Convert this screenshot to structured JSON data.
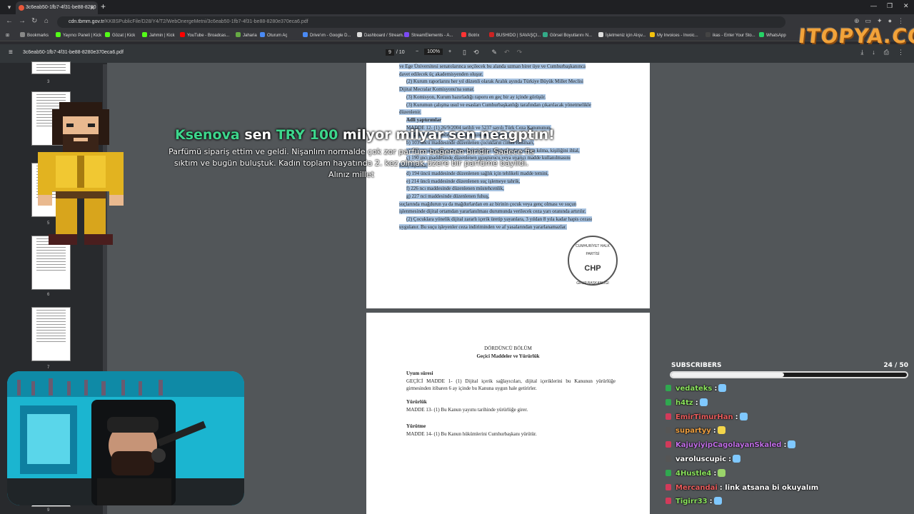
{
  "browser": {
    "tab_title": "3c6eab50-1fb7-4f31-be88-8280",
    "url_host": "cdn.tbmm.gov.tr",
    "url_path": "/KKBSPublicFile/D28/Y4/T2/WebOnergeMetni/3c6eab50-1fb7-4f31-be88-8280e370eca6.pdf",
    "bookmarks": [
      "Bookmarks",
      "Yayıncı Paneli | Kick",
      "Gözat | Kick",
      "Jahmin | Kick",
      "YouTube - Broadcas...",
      "Jaharia",
      "Oturum Aç",
      "Drive'ım - Google D...",
      "Dashboard / Stream...",
      "StreamElements - A...",
      "Botrix",
      "BUSHIDO | SAVAŞÇI...",
      "Görsel Boyutlarını N...",
      "İşletmeniz için Alışv...",
      "My Invoices - Invoic...",
      "ikas - Enter Your Sto...",
      "WhatsApp"
    ],
    "bookmark_colors": [
      "#888",
      "#53fc18",
      "#53fc18",
      "#53fc18",
      "#ff0000",
      "#6a4",
      "#4a8af4",
      "#4a8af4",
      "#ddd",
      "#7b4af4",
      "#f33",
      "#c22",
      "#3a8",
      "#ddd",
      "#f4c20d",
      "#444",
      "#25d366"
    ]
  },
  "logo_text": "ITOPYA.COM",
  "pdf": {
    "filename": "3c6eab50-1fb7-4f31-be88-8280e370eca6.pdf",
    "page_current": "9",
    "page_total": "/ 10",
    "zoom": "100%",
    "thumb_numbers": [
      "3",
      "5",
      "6",
      "7",
      "9"
    ],
    "page1_lines": [
      "ve Ege Üniversitesi senatolarınca seçilecek bu alanda uzman birer üye ve Cumhurbaşkanınca",
      "davet edilecek üç akademisyenden oluşur.",
      "(2) Kurum raporlarını her yıl düzenli olarak Aralık ayında Türkiye Büyük Millet Meclisi",
      "Dijital Mecralar Komisyonu'na sunar.",
      "(3) Komisyon, Kurum hazırladığı raporu en geç bir ay içinde görüşür.",
      "(3) Kurumun çalışma usul ve esasları Cumhurbaşkanlığı tarafından çıkarılacak yönetmelikle",
      "düzenlenir.",
      "",
      "Adli yaptırımlar",
      "MADDE 12- (1) 26/9/2004 tarihli ve 5237 sayılı Türk Ceza Kanununun,",
      "a) 82 nci maddesinde düzenlenen nitelikli öldürme,",
      "b) 103 üncü maddesinde düzenlenen çocukların cinsel istismarı,",
      "c) 109 uncu maddesinde düzenlenen kişiyi hürriyetinden yoksun kılma, kişiliğini ihlal,",
      "ç) 190 ıncı maddesinde düzenlenen uyuşturucu veya uyarıcı madde kullanılmasını",
      "kolaylaştırma,",
      "d) 194 üncü maddesinde düzenlenen sağlık için tehlikeli madde temini,",
      "e) 214 üncü maddesinde düzenlenen suç işlemeye tahrik,",
      "f) 226 ncı maddesinde düzenlenen müstehcenlik,",
      "g) 227 nci maddesinde düzenlenen fuhuş,",
      "suçlarında mağdurun ya da mağdurlardan en az birinin çocuk veya genç olması ve suçun",
      "işlenmesinde dijital ortamdan yararlanılması durumunda verilecek ceza yarı oranında artırılır.",
      "(2) Çocuklara yönelik dijital zararlı içerik üretip yayanlara, 3 yıldan 8 yıla kadar hapis cezası",
      "uygulanır. Bu suçu işleyenler ceza indiriminden ve af yasalarından yararlanamazlar."
    ],
    "stamp_top": "CUMHURİYET HALK PARTİSİ",
    "stamp_mid": "CHP",
    "stamp_bot": "GRUP BAŞKANLIĞI",
    "page2_heading": "DÖRDÜNCÜ BÖLÜM",
    "page2_subheading": "Geçici Maddeler ve Yürürlük",
    "page2_blocks": [
      {
        "title": "Uyum süresi",
        "body": "GEÇİCİ MADDE 1- (1) Dijital içerik sağlayıcıları, dijital içeriklerini bu Kanunun yürürlüğe girmesinden itibaren 6 ay içinde bu Kanuna uygun hale getirirler."
      },
      {
        "title": "Yürürlük",
        "body": "MADDE 13- (1) Bu Kanun yayımı tarihinde yürürlüğe girer."
      },
      {
        "title": "Yürütme",
        "body": "MADDE 14- (1) Bu Kanun hükümlerini Cumhurbaşkanı yürütür."
      }
    ]
  },
  "alert": {
    "name": "Ksenova",
    "mid": "sen",
    "amount": "TRY 100",
    "tail": "milyor milyar sen neagptın!",
    "message": "Parfümü sipariş ettim ve geldi. Nişanlım normalde çok zor parfüm beğenen biridir. Sadece fis sıktım ve bugün buluştuk. Kadın toplam hayatında 2. kez olmak üzere bir parfüme bayıldı. Alınız millet"
  },
  "subs": {
    "label": "SUBSCRIBERS",
    "count": "24 / 50",
    "progress": 0.48
  },
  "chat": [
    {
      "user": "vedateks",
      "text": ":",
      "color": "#8be45d",
      "badge": "#2fa84f"
    },
    {
      "user": "h4tz",
      "text": ":",
      "color": "#8be45d",
      "badge": "#2fa84f"
    },
    {
      "user": "EmirTimurHan",
      "text": ":",
      "color": "#e85b5b",
      "badge": "#d23a5a"
    },
    {
      "user": "supartyy",
      "text": ":",
      "color": "#f0a040",
      "badge": "#555"
    },
    {
      "user": "KajuyiyipCagolayanSkaled",
      "text": ":",
      "color": "#c26ee8",
      "badge": "#d23a5a"
    },
    {
      "user": "varoluscupic",
      "text": ":",
      "color": "#ffffff",
      "badge": "#555"
    },
    {
      "user": "4Hustle4",
      "text": ":",
      "color": "#8be45d",
      "badge": "#2fa84f"
    },
    {
      "user": "Mercandai",
      "text": ": link atsana bi okuyalım",
      "color": "#e85b5b",
      "badge": "#d23a5a"
    },
    {
      "user": "Tigirr33",
      "text": ":",
      "color": "#8be45d",
      "badge": "#d23a5a"
    }
  ]
}
